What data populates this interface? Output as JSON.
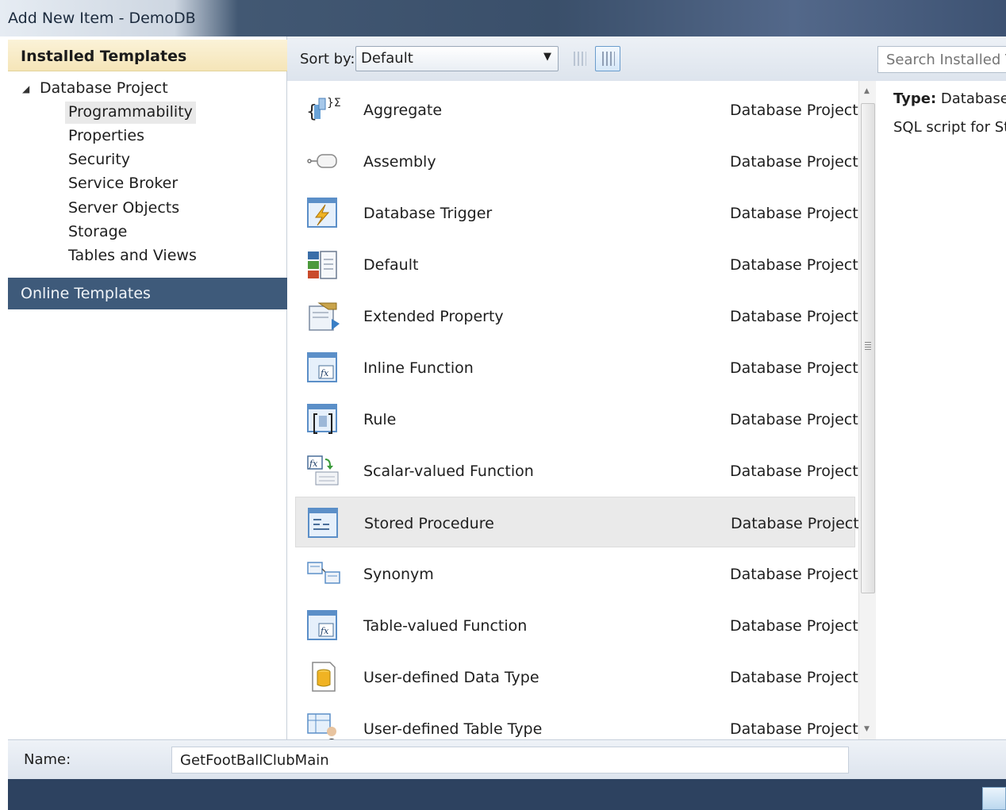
{
  "window": {
    "title": "Add New Item - DemoDB"
  },
  "left_pane": {
    "installed_header": "Installed Templates",
    "tree_root": "Database Project",
    "tree_children": [
      {
        "label": "Programmability",
        "selected": true
      },
      {
        "label": "Properties"
      },
      {
        "label": "Security"
      },
      {
        "label": "Service Broker"
      },
      {
        "label": "Server Objects"
      },
      {
        "label": "Storage"
      },
      {
        "label": "Tables and Views"
      }
    ],
    "online_header": "Online Templates"
  },
  "toolbar": {
    "sort_label": "Sort by:",
    "sort_value": "Default",
    "search_placeholder": "Search Installed Templates"
  },
  "items": [
    {
      "name": "Aggregate",
      "category": "Database Project",
      "icon": "aggregate-icon"
    },
    {
      "name": "Assembly",
      "category": "Database Project",
      "icon": "assembly-icon"
    },
    {
      "name": "Database Trigger",
      "category": "Database Project",
      "icon": "trigger-icon"
    },
    {
      "name": "Default",
      "category": "Database Project",
      "icon": "default-icon"
    },
    {
      "name": "Extended Property",
      "category": "Database Project",
      "icon": "extended-property-icon"
    },
    {
      "name": "Inline Function",
      "category": "Database Project",
      "icon": "function-icon"
    },
    {
      "name": "Rule",
      "category": "Database Project",
      "icon": "rule-icon"
    },
    {
      "name": "Scalar-valued Function",
      "category": "Database Project",
      "icon": "scalar-function-icon"
    },
    {
      "name": "Stored Procedure",
      "category": "Database Project",
      "icon": "stored-procedure-icon",
      "selected": true
    },
    {
      "name": "Synonym",
      "category": "Database Project",
      "icon": "synonym-icon"
    },
    {
      "name": "Table-valued Function",
      "category": "Database Project",
      "icon": "function-icon"
    },
    {
      "name": "User-defined Data Type",
      "category": "Database Project",
      "icon": "data-type-icon"
    },
    {
      "name": "User-defined Table Type",
      "category": "Database Project",
      "icon": "table-type-icon"
    }
  ],
  "details": {
    "type_label": "Type:",
    "type_value": "Database Project",
    "description": "SQL script for Stored Procedure"
  },
  "name_field": {
    "label": "Name:",
    "value": "GetFootBallClubMain"
  }
}
